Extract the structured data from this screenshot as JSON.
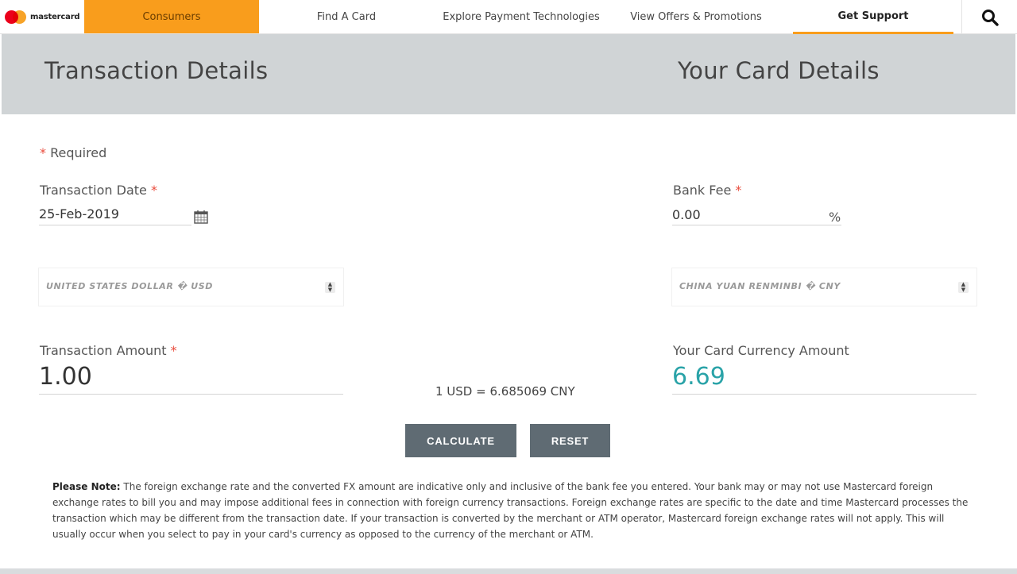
{
  "nav": {
    "logo_text": "mastercard",
    "items": [
      {
        "label": "Consumers"
      },
      {
        "label": "Find A Card"
      },
      {
        "label": "Explore Payment Technologies"
      },
      {
        "label": "View Offers & Promotions"
      },
      {
        "label": "Get Support"
      }
    ]
  },
  "header": {
    "left_title": "Transaction Details",
    "right_title": "Your Card Details"
  },
  "form": {
    "required_star": "*",
    "required_label": "Required",
    "transaction_date_label": "Transaction Date",
    "transaction_date_value": "25-Feb-2019",
    "bank_fee_label": "Bank Fee",
    "bank_fee_value": "0.00",
    "bank_fee_unit": "%",
    "from_currency": "UNITED STATES DOLLAR � USD",
    "to_currency": "CHINA YUAN RENMINBI � CNY",
    "transaction_amount_label": "Transaction Amount",
    "transaction_amount_value": "1.00",
    "card_amount_label": "Your Card Currency Amount",
    "card_amount_value": "6.69",
    "rate_text": "1 USD = 6.685069 CNY"
  },
  "buttons": {
    "calculate": "CALCULATE",
    "reset": "RESET"
  },
  "note": {
    "title": "Please Note:",
    "body": "The foreign exchange rate and the converted FX amount are indicative only and inclusive of the bank fee you entered. Your bank may or may not use Mastercard foreign exchange rates to bill you and may impose additional fees in connection with foreign currency transactions. Foreign exchange rates are specific to the date and time Mastercard processes the transaction which may be different from the transaction date. If your transaction is converted by the merchant or ATM operator, Mastercard foreign exchange rates will not apply. This will usually occur when you select to pay in your card's currency as opposed to the currency of the merchant or ATM."
  },
  "colors": {
    "accent": "#f99d1c",
    "teal_amount": "#2aa3a8",
    "button": "#5f6b73",
    "required": "#e94c3d"
  },
  "icons": [
    "mastercard-logo",
    "search-icon",
    "calendar-icon",
    "sort-arrows-icon"
  ]
}
